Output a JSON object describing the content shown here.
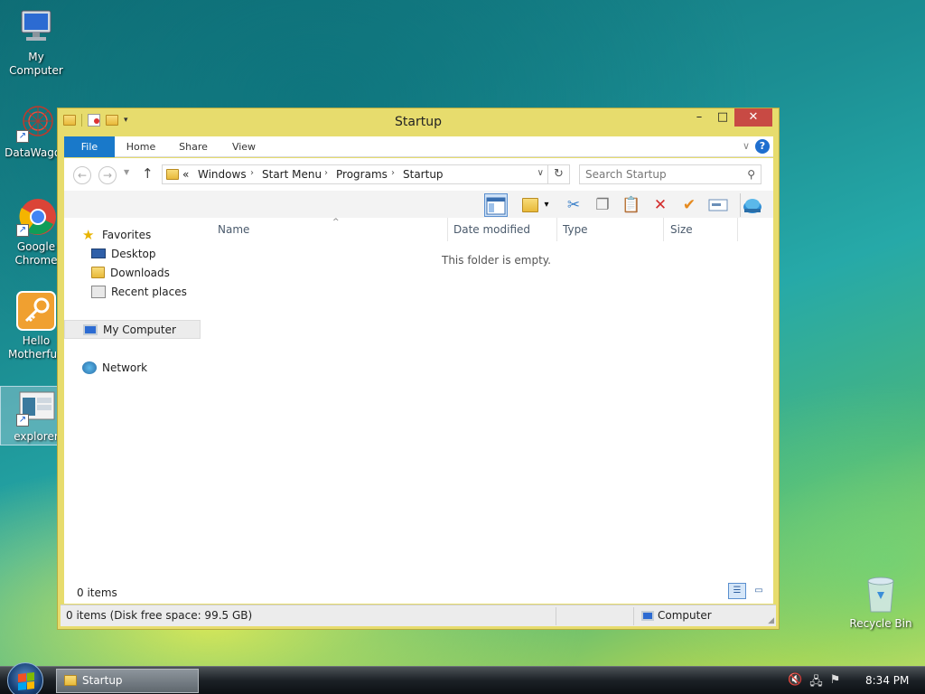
{
  "desktop": {
    "icons": [
      {
        "label": "My Computer"
      },
      {
        "label": "DataWagon"
      },
      {
        "label": "Google Chrome"
      },
      {
        "label": "Hello Motherfuck"
      },
      {
        "label": "explorer"
      },
      {
        "label": "Recycle Bin"
      }
    ]
  },
  "window": {
    "title": "Startup",
    "ribbon_tabs": [
      "File",
      "Home",
      "Share",
      "View"
    ],
    "address": {
      "overflow": "«",
      "crumbs": [
        "Windows",
        "Start Menu",
        "Programs",
        "Startup"
      ]
    },
    "search": {
      "placeholder": "Search Startup"
    },
    "nav_pane": {
      "favorites": "Favorites",
      "desktop": "Desktop",
      "downloads": "Downloads",
      "recent": "Recent places",
      "computer": "My Computer",
      "network": "Network"
    },
    "columns": [
      "Name",
      "Date modified",
      "Type",
      "Size"
    ],
    "empty_message": "This folder is empty.",
    "item_count": "0 items",
    "status_left": "0 items (Disk free space: 99.5 GB)",
    "status_right": "Computer"
  },
  "taskbar": {
    "task_label": "Startup",
    "clock": "8:34 PM"
  },
  "colors": {
    "titlebar": "#e7dc6d",
    "file_tab": "#1979ca",
    "close_button": "#c84a44"
  }
}
